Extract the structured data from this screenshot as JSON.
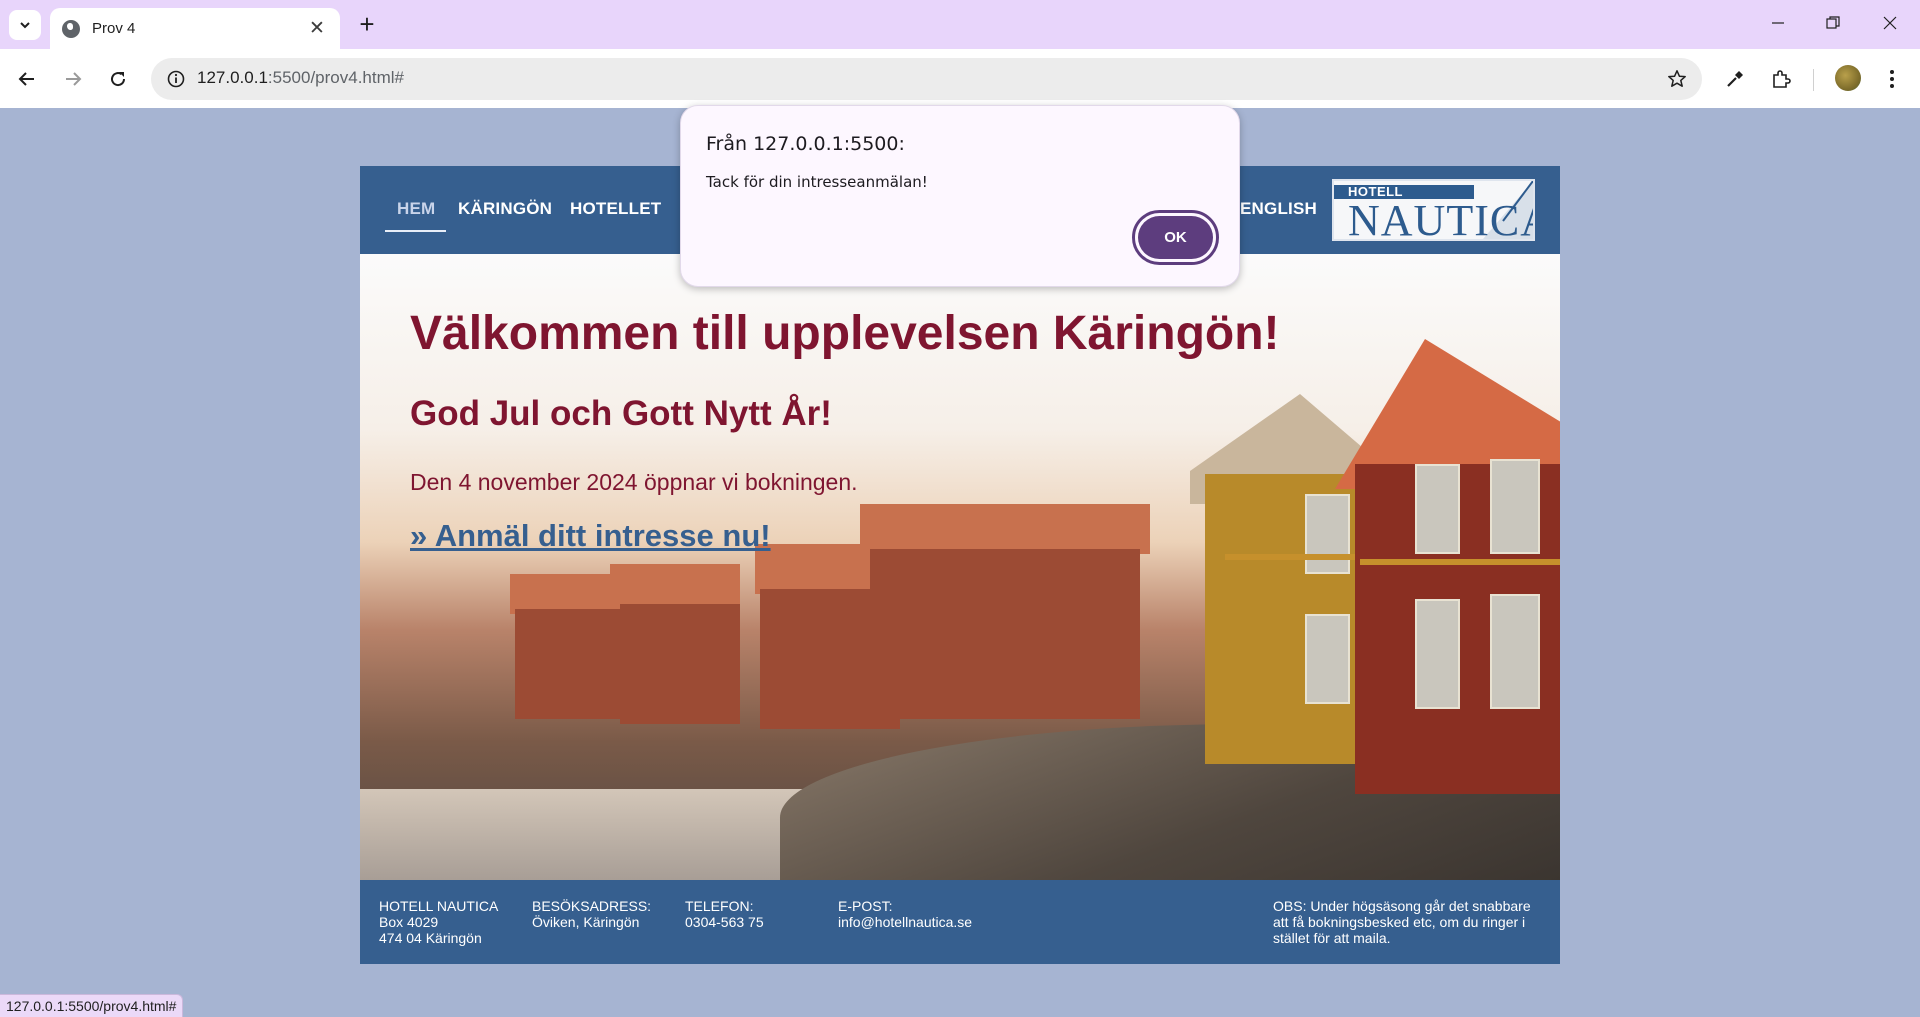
{
  "browser": {
    "tab_title": "Prov 4",
    "url_host": "127.0.0.1",
    "url_rest": ":5500/prov4.html#",
    "status_url": "127.0.0.1:5500/prov4.html#"
  },
  "site": {
    "nav": [
      "HEM",
      "KÄRINGÖN",
      "HOTELLET",
      "ENGLISH"
    ],
    "logo_top": "HOTELL",
    "logo_main": "NAUTICA",
    "welcome": "Välkommen till upplevelsen Käringön!",
    "greeting": "God Jul och Gott Nytt År!",
    "info": "Den 4 november 2024 öppnar vi bokningen.",
    "cta": "» Anmäl ditt intresse nu!",
    "footer": {
      "name": [
        "HOTELL NAUTICA",
        "Box 4029",
        "474 04 Käringön"
      ],
      "visit": [
        "BESÖKSADRESS:",
        "Öviken, Käringön"
      ],
      "phone": [
        "TELEFON:",
        "0304-563 75"
      ],
      "email": [
        "E-POST:",
        "info@hotellnautica.se"
      ],
      "note": [
        "OBS: Under högsäsong går det snabbare",
        "att få bokningsbesked etc, om du ringer i",
        "stället för att maila."
      ]
    }
  },
  "dialog": {
    "title": "Från 127.0.0.1:5500:",
    "message": "Tack för din intresseanmälan!",
    "ok_label": "OK"
  },
  "colors": {
    "page_bg": "#a6b4d2",
    "site_blue": "#365f8f",
    "heading_red": "#7f1530",
    "dialog_accent": "#5d3d7e",
    "tabstrip": "#e8d5fb"
  },
  "icons": [
    "tab-search-icon",
    "globe-favicon-icon",
    "close-icon",
    "plus-icon",
    "minimize-icon",
    "restore-icon",
    "window-close-icon",
    "back-arrow-icon",
    "forward-arrow-icon",
    "reload-icon",
    "site-info-icon",
    "bookmark-star-icon",
    "eyedropper-icon",
    "extensions-icon",
    "menu-dots-icon"
  ]
}
